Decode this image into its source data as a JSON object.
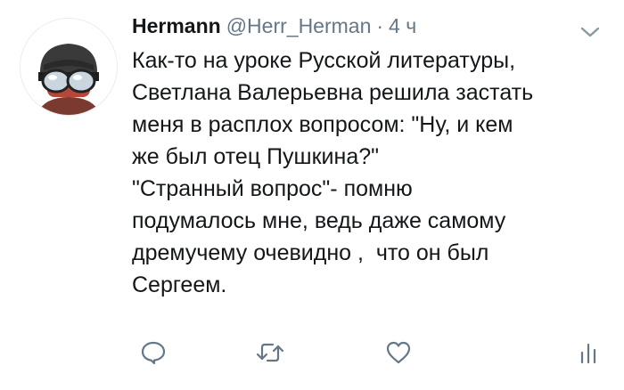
{
  "tweet": {
    "display_name": "Hermann",
    "handle": "@Herr_Herman",
    "separator": "·",
    "timestamp": "4 ч",
    "body_lines": [
      "Как-то на уроке Русской литературы,",
      "Светлана Валерьевна решила застать",
      "меня в расплох вопросом: \"Ну, и кем",
      "же был отец Пушкина?\"",
      "\"Странный вопрос\"- помню",
      "подумалось мне, ведь даже самому",
      "дремучему очевидно ,  что он был",
      "Сергеем."
    ]
  },
  "icons": {
    "caret": "chevron-down-icon",
    "reply": "reply-icon",
    "retweet": "retweet-icon",
    "like": "heart-icon",
    "analytics": "analytics-icon"
  },
  "colors": {
    "text": "#14171a",
    "secondary": "#657786",
    "icon": "#657786"
  }
}
